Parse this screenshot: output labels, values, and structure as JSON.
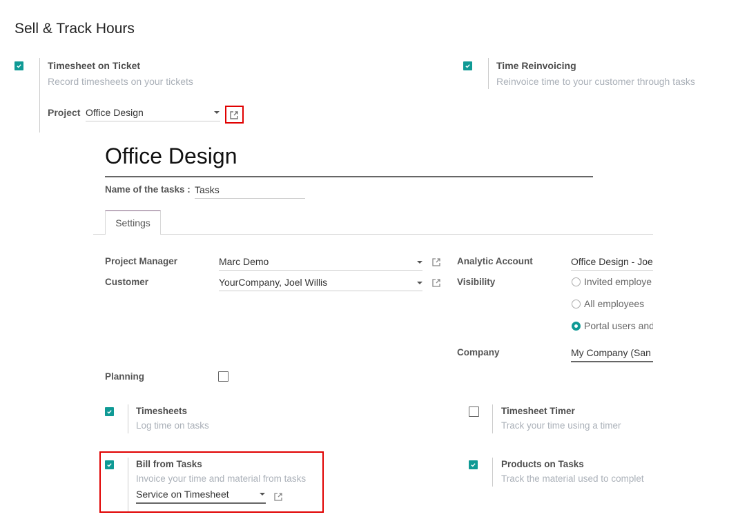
{
  "section": {
    "title": "Sell & Track Hours"
  },
  "settings": {
    "timesheet_on_ticket": {
      "title": "Timesheet on Ticket",
      "description": "Record timesheets on your tickets",
      "checked": true,
      "project_label": "Project",
      "project_value": "Office Design"
    },
    "time_reinvoicing": {
      "title": "Time Reinvoicing",
      "description": "Reinvoice time to your customer through tasks",
      "checked": true
    }
  },
  "form": {
    "title": "Office Design",
    "task_name_label": "Name of the tasks :",
    "task_name_value": "Tasks",
    "tabs": [
      {
        "label": "Settings",
        "active": true
      }
    ],
    "fields": {
      "project_manager": {
        "label": "Project Manager",
        "value": "Marc Demo"
      },
      "customer": {
        "label": "Customer",
        "value": "YourCompany, Joel Willis"
      },
      "analytic_account": {
        "label": "Analytic Account",
        "value": "Office Design - Joe"
      },
      "visibility": {
        "label": "Visibility",
        "options": [
          {
            "label": "Invited employe",
            "selected": false
          },
          {
            "label": "All employees",
            "selected": false
          },
          {
            "label": "Portal users and",
            "selected": true
          }
        ]
      },
      "company": {
        "label": "Company",
        "value": "My Company (San"
      },
      "planning": {
        "label": "Planning",
        "checked": false
      }
    },
    "options": {
      "timesheets": {
        "title": "Timesheets",
        "description": "Log time on tasks",
        "checked": true
      },
      "timesheet_timer": {
        "title": "Timesheet Timer",
        "description": "Track your time using a timer",
        "checked": false
      },
      "bill_from_tasks": {
        "title": "Bill from Tasks",
        "description": "Invoice your time and material from tasks",
        "checked": true,
        "value": "Service on Timesheet"
      },
      "products_on_tasks": {
        "title": "Products on Tasks",
        "description": "Track the material used to complet",
        "checked": true
      }
    }
  },
  "colors": {
    "accent": "#0f9a95",
    "highlight": "#e00000",
    "tab_top": "#7c5a7c"
  }
}
